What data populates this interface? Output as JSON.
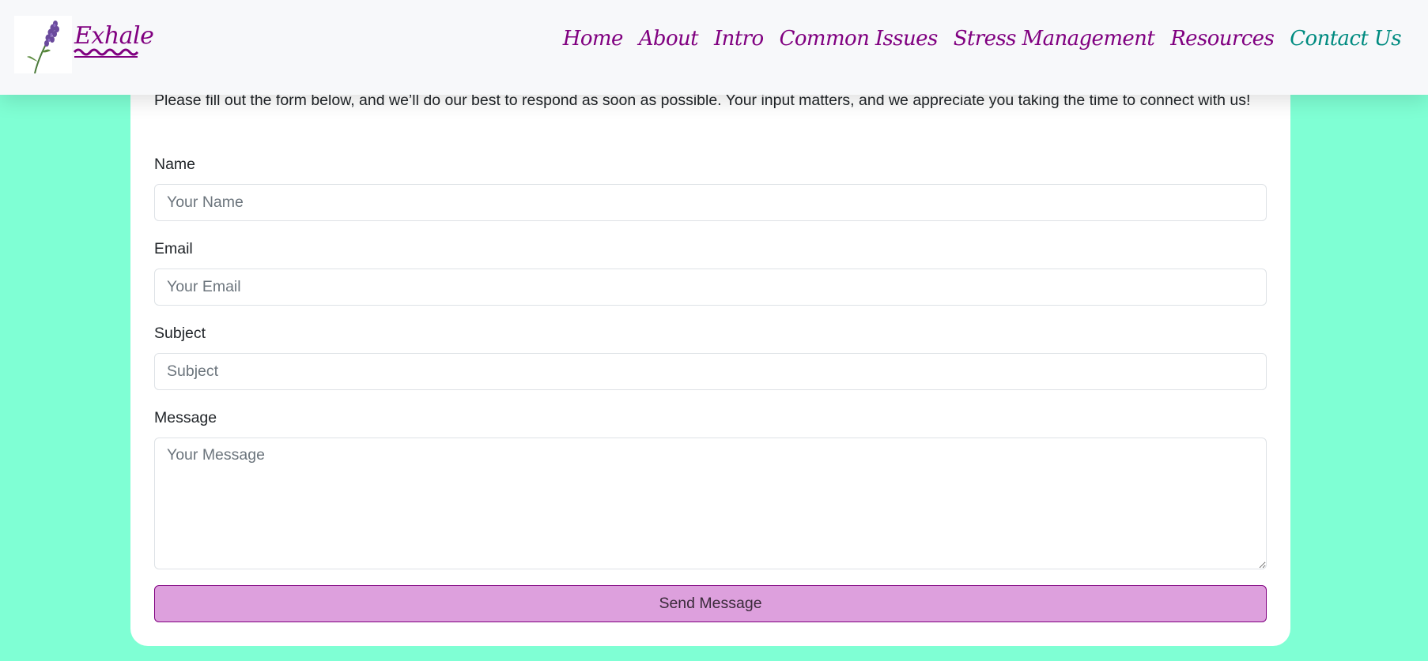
{
  "brand": {
    "name": "Exhale",
    "logo_icon": "lavender-sprig-icon",
    "color": "#800080"
  },
  "nav": {
    "items": [
      {
        "label": "Home"
      },
      {
        "label": "About"
      },
      {
        "label": "Intro"
      },
      {
        "label": "Common Issues"
      },
      {
        "label": "Stress Management"
      },
      {
        "label": "Resources"
      },
      {
        "label": "Contact Us"
      }
    ],
    "active": "Contact Us",
    "link_color": "#800080",
    "active_color": "#008b80"
  },
  "form": {
    "intro": "Please fill out the form below, and we’ll do our best to respond as soon as possible. Your input matters, and we appreciate you taking the time to connect with us!",
    "name": {
      "label": "Name",
      "placeholder": "Your Name",
      "value": ""
    },
    "email": {
      "label": "Email",
      "placeholder": "Your Email",
      "value": ""
    },
    "subject": {
      "label": "Subject",
      "placeholder": "Subject",
      "value": ""
    },
    "message": {
      "label": "Message",
      "placeholder": "Your Message",
      "value": ""
    },
    "submit_label": "Send Message"
  },
  "colors": {
    "page_background": "#7fffd4",
    "button_background": "#dda0dd",
    "button_border": "#800080"
  }
}
